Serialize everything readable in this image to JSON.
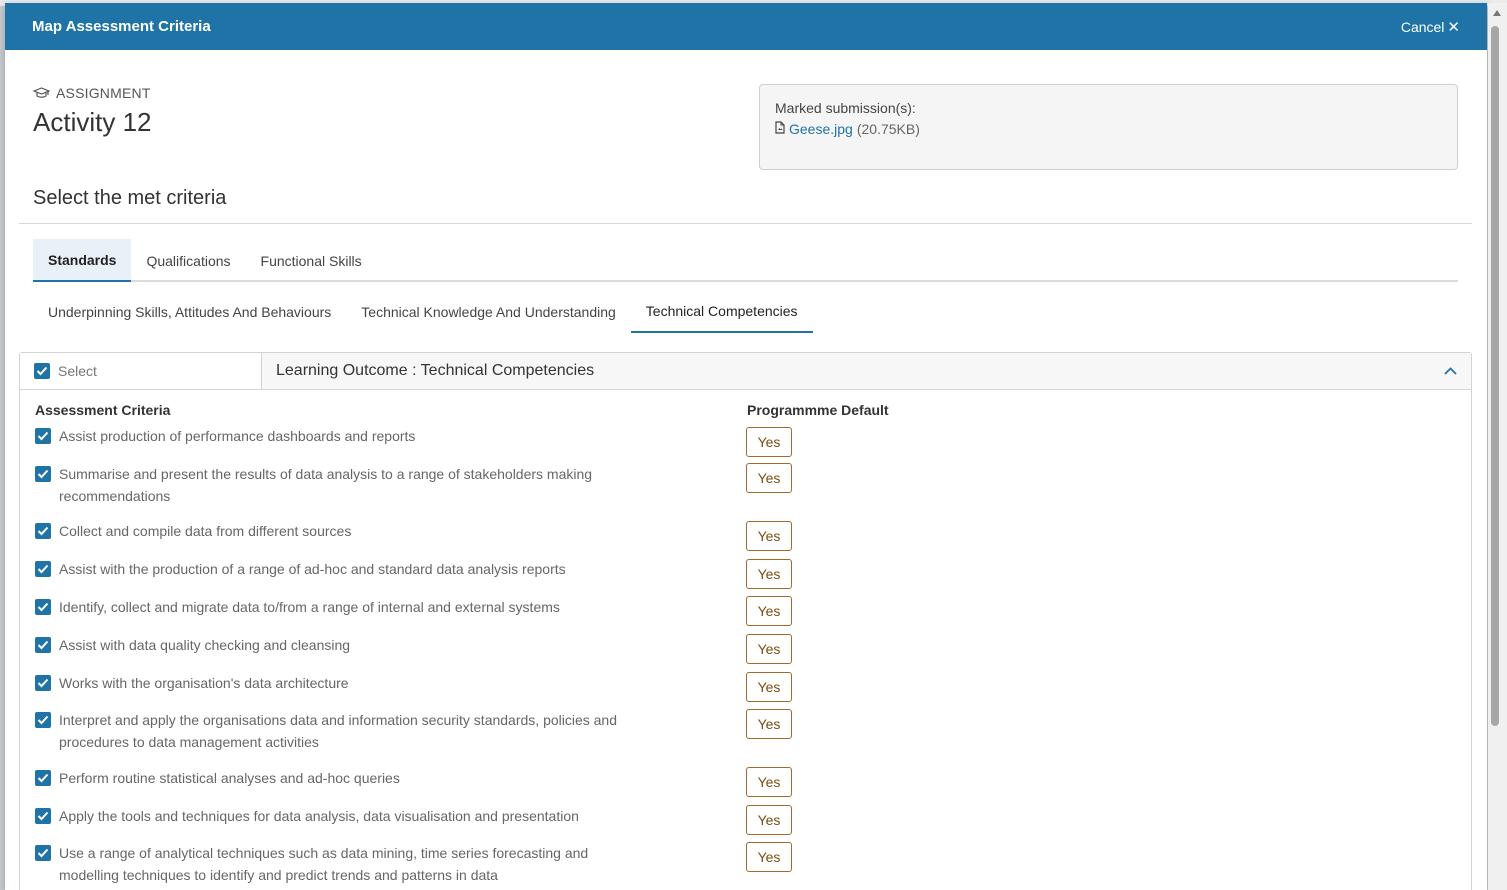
{
  "modal": {
    "title": "Map Assessment Criteria",
    "cancel_label": "Cancel",
    "cancel_icon": "close-icon"
  },
  "assignment": {
    "type_label": "ASSIGNMENT",
    "type_icon": "graduation-cap-icon",
    "title": "Activity 12"
  },
  "submission": {
    "label": "Marked submission(s):",
    "file_icon": "file-icon",
    "file_name": "Geese.jpg",
    "file_size": "(20.75KB)"
  },
  "section_title": "Select the met criteria",
  "primary_tabs": [
    {
      "label": "Standards",
      "active": true
    },
    {
      "label": "Qualifications",
      "active": false
    },
    {
      "label": "Functional Skills",
      "active": false
    }
  ],
  "secondary_tabs": [
    {
      "label": "Underpinning Skills, Attitudes And Behaviours",
      "active": false
    },
    {
      "label": "Technical Knowledge And Understanding",
      "active": false
    },
    {
      "label": "Technical Competencies",
      "active": true
    }
  ],
  "outcome": {
    "select_label": "Select",
    "select_checked": true,
    "title": "Learning Outcome : Technical Competencies",
    "collapse_icon": "chevron-up-icon",
    "col_criteria": "Assessment Criteria",
    "col_default": "Programmme Default",
    "criteria": [
      {
        "text": "Assist production of performance dashboards and reports",
        "default": "Yes",
        "checked": true
      },
      {
        "text": "Summarise and present the results of data analysis to a range of stakeholders making recommendations",
        "default": "Yes",
        "checked": true
      },
      {
        "text": "Collect and compile data from different sources",
        "default": "Yes",
        "checked": true
      },
      {
        "text": "Assist with the production of a range of ad-hoc and standard data analysis reports",
        "default": "Yes",
        "checked": true
      },
      {
        "text": "Identify, collect and migrate data to/from a range of internal and external systems",
        "default": "Yes",
        "checked": true
      },
      {
        "text": "Assist with data quality checking and cleansing",
        "default": "Yes",
        "checked": true
      },
      {
        "text": "Works with the organisation's data architecture",
        "default": "Yes",
        "checked": true
      },
      {
        "text": "Interpret and apply the organisations data and information security standards, policies and procedures to data management activities",
        "default": "Yes",
        "checked": true
      },
      {
        "text": "Perform routine statistical analyses and ad-hoc queries",
        "default": "Yes",
        "checked": true
      },
      {
        "text": "Apply the tools and techniques for data analysis, data visualisation and presentation",
        "default": "Yes",
        "checked": true
      },
      {
        "text": "Use a range of analytical techniques such as data mining, time series forecasting and modelling techniques to identify and predict trends and patterns in data",
        "default": "Yes",
        "checked": true
      }
    ]
  },
  "colors": {
    "accent": "#1f73a7",
    "badge_border": "#a06a2b"
  }
}
